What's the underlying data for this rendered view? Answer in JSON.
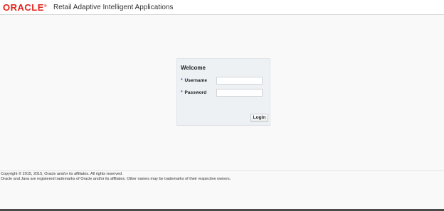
{
  "header": {
    "logo_text": "ORACLE",
    "logo_mark": "®",
    "app_title": "Retail Adaptive Intelligent Applications"
  },
  "login": {
    "heading": "Welcome",
    "required_marker": "*",
    "username_label": "Username",
    "username_value": "",
    "password_label": "Password",
    "password_value": "",
    "login_button": "Login"
  },
  "footer": {
    "copyright": "Copyright © 2015, 2015, Oracle and/or its affiliates. All rights reserved.",
    "trademark": "Oracle and Java are registered trademarks of Oracle and/or its affiliates. Other names may be trademarks of their respective owners."
  },
  "colors": {
    "brand": "#e2231a",
    "required": "#3b6fa8",
    "panel": "#eef1f4"
  }
}
